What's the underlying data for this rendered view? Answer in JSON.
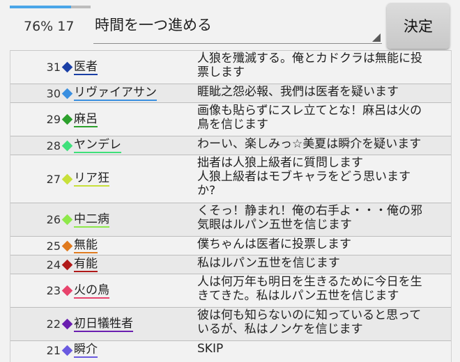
{
  "header": {
    "progress_text": "76% 17",
    "progress_fraction": 0.76,
    "select_value": "時間を一つ進める",
    "decide_label": "決定"
  },
  "colors": {
    "progress": "#4aa6e8"
  },
  "rows": [
    {
      "num": "31",
      "name": "医者",
      "color": "#1a3fa6",
      "lines": [
        "人狼を殲滅する。俺とカドクラは無能に投",
        "票します"
      ]
    },
    {
      "num": "30",
      "name": "リヴァイアサン",
      "color": "#3a8fe0",
      "lines": [
        "睚眦之怨必報、我們は医者を疑います"
      ]
    },
    {
      "num": "29",
      "name": "麻呂",
      "color": "#2ca02c",
      "lines": [
        "画像も貼らずにスレ立てとな！麻呂は火の",
        "鳥を信じます"
      ]
    },
    {
      "num": "28",
      "name": "ヤンデレ",
      "color": "#3ee07a",
      "lines": [
        "わーい、楽しみっ☆美夏は瞬介を疑います"
      ]
    },
    {
      "num": "27",
      "name": "リア狂",
      "color": "#c8e03a",
      "lines": [
        "拙者は人狼上級者に質問します",
        "人狼上級者はモブキャラをどう思います",
        "か?"
      ]
    },
    {
      "num": "26",
      "name": "中二病",
      "color": "#8ee84a",
      "lines": [
        "くそっ！静まれ！俺の右手よ・・・俺の邪",
        "気眼はルパン五世を信じます"
      ]
    },
    {
      "num": "25",
      "name": "無能",
      "color": "#e07a1e",
      "lines": [
        "僕ちゃんは医者に投票します"
      ]
    },
    {
      "num": "24",
      "name": "有能",
      "color": "#b01818",
      "lines": [
        "私はルパン五世を信じます"
      ]
    },
    {
      "num": "23",
      "name": "火の鳥",
      "color": "#e8436c",
      "lines": [
        "人は何万年も明日を生きるために今日を生",
        "きてきた。私はルパン五世を信じます"
      ]
    },
    {
      "num": "22",
      "name": "初日犠牲者",
      "color": "#6a1eb0",
      "lines": [
        "彼は何も知らないのに知っていると思って",
        "いるが、私はノンケを信じます"
      ]
    },
    {
      "num": "21",
      "name": "瞬介",
      "color": "#6a5ae0",
      "lines": [
        "SKIP"
      ]
    }
  ]
}
